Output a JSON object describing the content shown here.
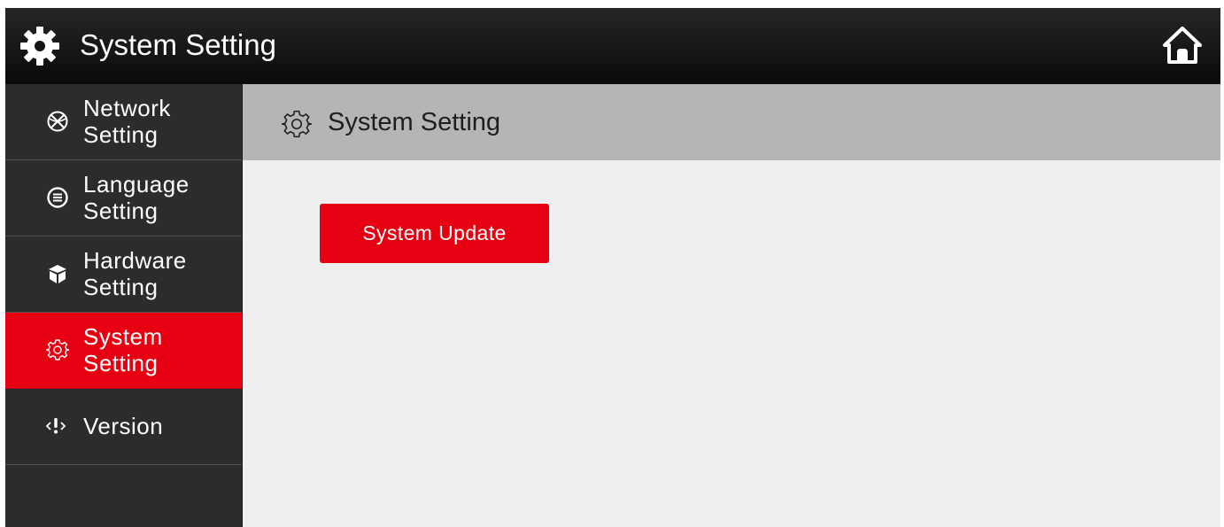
{
  "app": {
    "title": "System Setting",
    "title_icon": "gear-icon",
    "home_icon": "home-icon"
  },
  "sidebar": {
    "items": [
      {
        "line1": "Network",
        "line2": "Setting",
        "icon": "globe-icon",
        "active": false
      },
      {
        "line1": "Language",
        "line2": "Setting",
        "icon": "language-icon",
        "active": false
      },
      {
        "line1": "Hardware",
        "line2": "Setting",
        "icon": "cube-icon",
        "active": false
      },
      {
        "line1": "System",
        "line2": "Setting",
        "icon": "gear-outline-icon",
        "active": true
      },
      {
        "line1": "Version",
        "icon": "info-code-icon",
        "active": false
      }
    ]
  },
  "content": {
    "header_title": "System Setting",
    "header_icon": "gear-outline-icon",
    "update_button_label": "System Update"
  },
  "colors": {
    "accent": "#e60012",
    "titlebar": "#111111",
    "sidebar": "#2c2c2c",
    "content_header": "#b5b5b5",
    "content_bg": "#eeefee"
  }
}
